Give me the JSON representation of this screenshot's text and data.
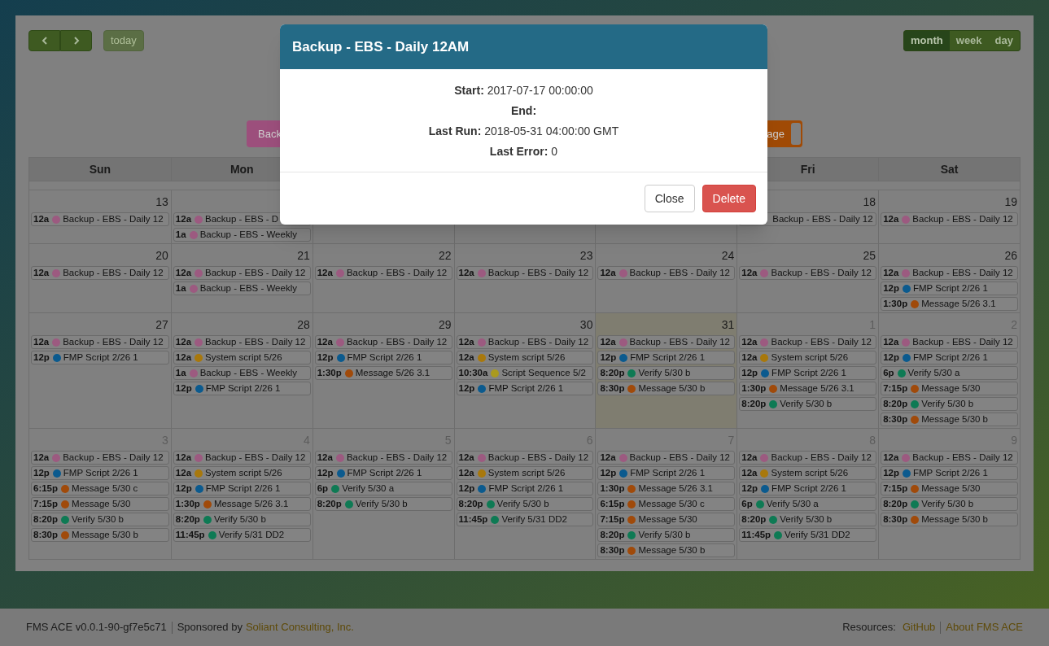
{
  "toolbar": {
    "nav": [
      {
        "kind": "prev"
      },
      {
        "kind": "next"
      }
    ],
    "today": {
      "label": "today",
      "disabled": true
    },
    "views": [
      {
        "label": "month",
        "selected": true
      },
      {
        "label": "week",
        "selected": false
      },
      {
        "label": "day",
        "selected": false
      }
    ]
  },
  "legend": [
    {
      "label": "Back",
      "color": "#9c4f7c"
    },
    {
      "label": "age",
      "color": "#a04a05"
    }
  ],
  "weekdays_left": [
    "Sun",
    "Mon"
  ],
  "weekdays_right": [
    "Fri",
    "Sat"
  ],
  "weeks": [
    {
      "days_left": [
        {
          "date": "13",
          "muted": false,
          "today": false,
          "events": [
            {
              "time": "12a",
              "title": "Backup - EBS - Daily 12",
              "color": "#9c5a80"
            }
          ]
        },
        {
          "events": [
            {
              "time": "12a",
              "title": "Backup - EBS - D",
              "color": "#9c5a80"
            },
            {
              "time": "1a",
              "title": "Backup - EBS - Weekly",
              "color": "#9c5a80"
            }
          ]
        }
      ],
      "days_right": [
        {
          "date": "18",
          "muted": false,
          "today": false,
          "events": [
            {
              "title": "Backup - EBS - Daily 12"
            }
          ]
        },
        {
          "date": "19",
          "muted": false,
          "today": false,
          "events": [
            {
              "time": "12a",
              "title": "Backup - EBS - Daily 12",
              "color": "#9c5a80"
            }
          ]
        }
      ]
    },
    {
      "days": [
        {
          "date": "20",
          "muted": false,
          "today": false,
          "events": [
            {
              "time": "12a",
              "title": "Backup - EBS - Daily 12",
              "color": "#9c5a80"
            }
          ]
        },
        {
          "date": "21",
          "muted": false,
          "today": false,
          "events": [
            {
              "time": "12a",
              "title": "Backup - EBS - Daily 12",
              "color": "#9c5a80"
            },
            {
              "time": "1a",
              "title": "Backup - EBS - Weekly",
              "color": "#9c5a80"
            }
          ]
        },
        {
          "date": "22",
          "muted": false,
          "today": false,
          "events": [
            {
              "time": "12a",
              "title": "Backup - EBS - Daily 12",
              "color": "#9c5a80"
            }
          ]
        },
        {
          "date": "23",
          "muted": false,
          "today": false,
          "events": [
            {
              "time": "12a",
              "title": "Backup - EBS - Daily 12",
              "color": "#9c5a80"
            }
          ]
        },
        {
          "date": "24",
          "muted": false,
          "today": false,
          "events": [
            {
              "time": "12a",
              "title": "Backup - EBS - Daily 12",
              "color": "#9c5a80"
            }
          ]
        },
        {
          "date": "25",
          "muted": false,
          "today": false,
          "events": [
            {
              "time": "12a",
              "title": "Backup - EBS - Daily 12",
              "color": "#9c5a80"
            }
          ]
        },
        {
          "date": "26",
          "muted": false,
          "today": false,
          "events": [
            {
              "time": "12a",
              "title": "Backup - EBS - Daily 12",
              "color": "#9c5a80"
            },
            {
              "time": "12p",
              "title": "FMP Script 2/26 1",
              "color": "#0b5a8e"
            },
            {
              "time": "1:30p",
              "title": "Message 5/26 3.1",
              "color": "#a04a0a"
            }
          ]
        }
      ]
    },
    {
      "days": [
        {
          "date": "27",
          "muted": false,
          "today": false,
          "events": [
            {
              "time": "12a",
              "title": "Backup - EBS - Daily 12",
              "color": "#9c5a80"
            },
            {
              "time": "12p",
              "title": "FMP Script 2/26 1",
              "color": "#0b5a8e"
            }
          ]
        },
        {
          "date": "28",
          "muted": false,
          "today": false,
          "events": [
            {
              "time": "12a",
              "title": "Backup - EBS - Daily 12",
              "color": "#9c5a80"
            },
            {
              "time": "12a",
              "title": "System script 5/26",
              "color": "#a8780c"
            },
            {
              "time": "1a",
              "title": "Backup - EBS - Weekly",
              "color": "#9c5a80"
            },
            {
              "time": "12p",
              "title": "FMP Script 2/26 1",
              "color": "#0b5a8e"
            }
          ]
        },
        {
          "date": "29",
          "muted": false,
          "today": false,
          "events": [
            {
              "time": "12a",
              "title": "Backup - EBS - Daily 12",
              "color": "#9c5a80"
            },
            {
              "time": "12p",
              "title": "FMP Script 2/26 1",
              "color": "#0b5a8e"
            },
            {
              "time": "1:30p",
              "title": "Message 5/26 3.1",
              "color": "#a04a0a"
            }
          ]
        },
        {
          "date": "30",
          "muted": false,
          "today": false,
          "events": [
            {
              "time": "12a",
              "title": "Backup - EBS - Daily 12",
              "color": "#9c5a80"
            },
            {
              "time": "12a",
              "title": "System script 5/26",
              "color": "#a8780c"
            },
            {
              "time": "10:30a",
              "title": "Script Sequence 5/2",
              "color": "#aa9a1e"
            },
            {
              "time": "12p",
              "title": "FMP Script 2/26 1",
              "color": "#0b5a8e"
            }
          ]
        },
        {
          "date": "31",
          "muted": false,
          "today": true,
          "events": [
            {
              "time": "12a",
              "title": "Backup - EBS - Daily 12",
              "color": "#9c5a80"
            },
            {
              "time": "12p",
              "title": "FMP Script 2/26 1",
              "color": "#0b5a8e"
            },
            {
              "time": "8:20p",
              "title": "Verify 5/30 b",
              "color": "#0e7a54"
            },
            {
              "time": "8:30p",
              "title": "Message 5/30 b",
              "color": "#a04a0a"
            }
          ]
        },
        {
          "date": "1",
          "muted": true,
          "today": false,
          "events": [
            {
              "time": "12a",
              "title": "Backup - EBS - Daily 12",
              "color": "#9c5a80"
            },
            {
              "time": "12a",
              "title": "System script 5/26",
              "color": "#a8780c"
            },
            {
              "time": "12p",
              "title": "FMP Script 2/26 1",
              "color": "#0b5a8e"
            },
            {
              "time": "1:30p",
              "title": "Message 5/26 3.1",
              "color": "#a04a0a"
            },
            {
              "time": "8:20p",
              "title": "Verify 5/30 b",
              "color": "#0e7a54"
            }
          ]
        },
        {
          "date": "2",
          "muted": true,
          "today": false,
          "events": [
            {
              "time": "12a",
              "title": "Backup - EBS - Daily 12",
              "color": "#9c5a80"
            },
            {
              "time": "12p",
              "title": "FMP Script 2/26 1",
              "color": "#0b5a8e"
            },
            {
              "time": "6p",
              "title": "Verify 5/30 a",
              "color": "#0e7a54"
            },
            {
              "time": "7:15p",
              "title": "Message 5/30",
              "color": "#a04a0a"
            },
            {
              "time": "8:20p",
              "title": "Verify 5/30 b",
              "color": "#0e7a54"
            },
            {
              "time": "8:30p",
              "title": "Message 5/30 b",
              "color": "#a04a0a"
            }
          ]
        }
      ]
    },
    {
      "days": [
        {
          "date": "3",
          "muted": true,
          "today": false,
          "events": [
            {
              "time": "12a",
              "title": "Backup - EBS - Daily 12",
              "color": "#9c5a80"
            },
            {
              "time": "12p",
              "title": "FMP Script 2/26 1",
              "color": "#0b5a8e"
            },
            {
              "time": "6:15p",
              "title": "Message 5/30 c",
              "color": "#a04a0a"
            },
            {
              "time": "7:15p",
              "title": "Message 5/30",
              "color": "#a04a0a"
            },
            {
              "time": "8:20p",
              "title": "Verify 5/30 b",
              "color": "#0e7a54"
            },
            {
              "time": "8:30p",
              "title": "Message 5/30 b",
              "color": "#a04a0a"
            }
          ]
        },
        {
          "date": "4",
          "muted": true,
          "today": false,
          "events": [
            {
              "time": "12a",
              "title": "Backup - EBS - Daily 12",
              "color": "#9c5a80"
            },
            {
              "time": "12a",
              "title": "System script 5/26",
              "color": "#a8780c"
            },
            {
              "time": "12p",
              "title": "FMP Script 2/26 1",
              "color": "#0b5a8e"
            },
            {
              "time": "1:30p",
              "title": "Message 5/26 3.1",
              "color": "#a04a0a"
            },
            {
              "time": "8:20p",
              "title": "Verify 5/30 b",
              "color": "#0e7a54"
            },
            {
              "time": "11:45p",
              "title": "Verify 5/31 DD2",
              "color": "#0e7a54"
            }
          ]
        },
        {
          "date": "5",
          "muted": true,
          "today": false,
          "events": [
            {
              "time": "12a",
              "title": "Backup - EBS - Daily 12",
              "color": "#9c5a80"
            },
            {
              "time": "12p",
              "title": "FMP Script 2/26 1",
              "color": "#0b5a8e"
            },
            {
              "time": "6p",
              "title": "Verify 5/30 a",
              "color": "#0e7a54"
            },
            {
              "time": "8:20p",
              "title": "Verify 5/30 b",
              "color": "#0e7a54"
            }
          ]
        },
        {
          "date": "6",
          "muted": true,
          "today": false,
          "events": [
            {
              "time": "12a",
              "title": "Backup - EBS - Daily 12",
              "color": "#9c5a80"
            },
            {
              "time": "12a",
              "title": "System script 5/26",
              "color": "#a8780c"
            },
            {
              "time": "12p",
              "title": "FMP Script 2/26 1",
              "color": "#0b5a8e"
            },
            {
              "time": "8:20p",
              "title": "Verify 5/30 b",
              "color": "#0e7a54"
            },
            {
              "time": "11:45p",
              "title": "Verify 5/31 DD2",
              "color": "#0e7a54"
            }
          ]
        },
        {
          "date": "7",
          "muted": true,
          "today": false,
          "events": [
            {
              "time": "12a",
              "title": "Backup - EBS - Daily 12",
              "color": "#9c5a80"
            },
            {
              "time": "12p",
              "title": "FMP Script 2/26 1",
              "color": "#0b5a8e"
            },
            {
              "time": "1:30p",
              "title": "Message 5/26 3.1",
              "color": "#a04a0a"
            },
            {
              "time": "6:15p",
              "title": "Message 5/30 c",
              "color": "#a04a0a"
            },
            {
              "time": "7:15p",
              "title": "Message 5/30",
              "color": "#a04a0a"
            },
            {
              "time": "8:20p",
              "title": "Verify 5/30 b",
              "color": "#0e7a54"
            },
            {
              "time": "8:30p",
              "title": "Message 5/30 b",
              "color": "#a04a0a"
            }
          ]
        },
        {
          "date": "8",
          "muted": true,
          "today": false,
          "events": [
            {
              "time": "12a",
              "title": "Backup - EBS - Daily 12",
              "color": "#9c5a80"
            },
            {
              "time": "12a",
              "title": "System script 5/26",
              "color": "#a8780c"
            },
            {
              "time": "12p",
              "title": "FMP Script 2/26 1",
              "color": "#0b5a8e"
            },
            {
              "time": "6p",
              "title": "Verify 5/30 a",
              "color": "#0e7a54"
            },
            {
              "time": "8:20p",
              "title": "Verify 5/30 b",
              "color": "#0e7a54"
            },
            {
              "time": "11:45p",
              "title": "Verify 5/31 DD2",
              "color": "#0e7a54"
            }
          ]
        },
        {
          "date": "9",
          "muted": true,
          "today": false,
          "events": [
            {
              "time": "12a",
              "title": "Backup - EBS - Daily 12",
              "color": "#9c5a80"
            },
            {
              "time": "12p",
              "title": "FMP Script 2/26 1",
              "color": "#0b5a8e"
            },
            {
              "time": "7:15p",
              "title": "Message 5/30",
              "color": "#a04a0a"
            },
            {
              "time": "8:20p",
              "title": "Verify 5/30 b",
              "color": "#0e7a54"
            },
            {
              "time": "8:30p",
              "title": "Message 5/30 b",
              "color": "#a04a0a"
            }
          ]
        }
      ]
    }
  ],
  "modal": {
    "title": "Backup - EBS - Daily 12AM",
    "details": [
      {
        "label": "Start:",
        "value": "2017-07-17 00:00:00"
      },
      {
        "label": "End:"
      },
      {
        "label": "Last Run:",
        "value": "2018-05-31 04:00:00 GMT"
      },
      {
        "label": "Last Error:",
        "value": "0"
      }
    ],
    "buttons": [
      {
        "label": "Close",
        "kind": "default"
      },
      {
        "label": "Delete",
        "kind": "danger"
      }
    ]
  },
  "footer": {
    "version": "FMS ACE v0.0.1-90-gf7e5c71",
    "sponsor_text": "Sponsored by",
    "sponsor_link": "Soliant Consulting, Inc.",
    "resources_label": "Resources:",
    "links": [
      "GitHub",
      "About FMS ACE"
    ]
  }
}
